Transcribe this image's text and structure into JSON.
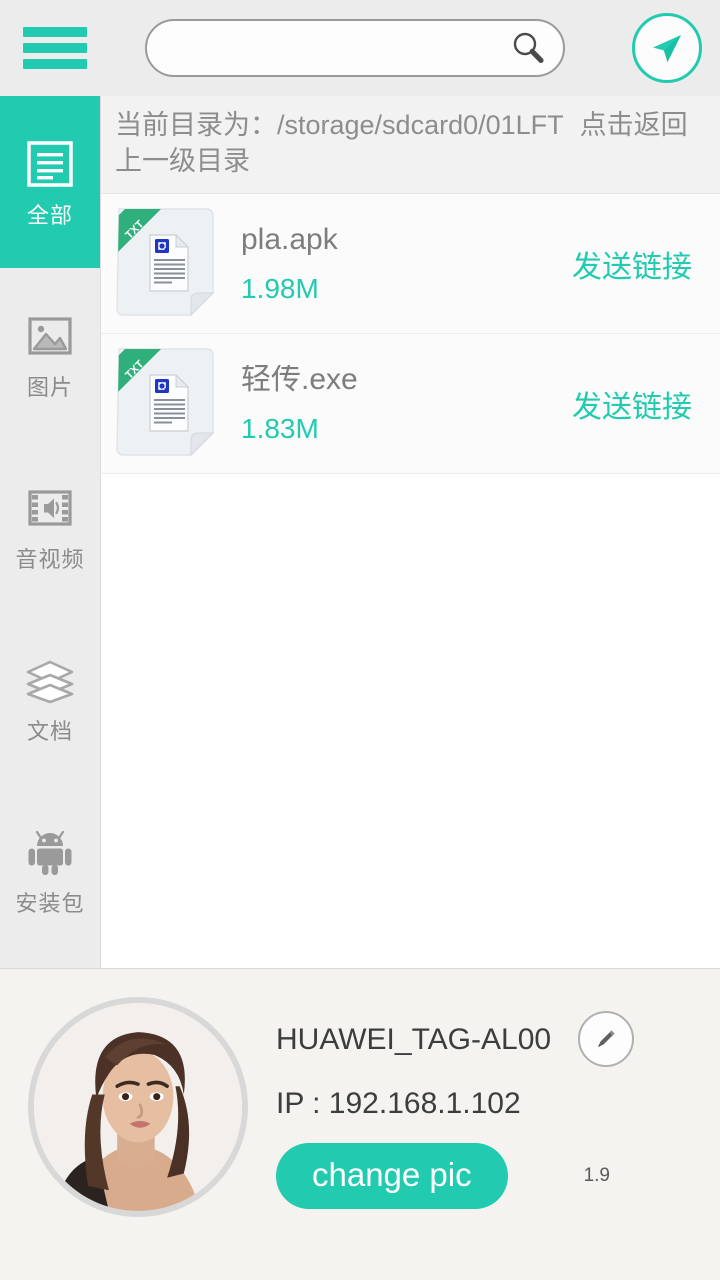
{
  "topbar": {
    "menu_icon": "hamburger-menu-icon",
    "search": {
      "value": "",
      "placeholder": ""
    },
    "search_icon": "search-icon",
    "send_icon": "send-paper-plane-icon"
  },
  "sidebar": {
    "items": [
      {
        "label": "全部",
        "icon": "document-lines-icon",
        "active": true
      },
      {
        "label": "图片",
        "icon": "image-picture-icon",
        "active": false
      },
      {
        "label": "音视频",
        "icon": "film-audio-icon",
        "active": false
      },
      {
        "label": "文档",
        "icon": "layers-stack-icon",
        "active": false
      },
      {
        "label": "安装包",
        "icon": "android-robot-icon",
        "active": false
      }
    ]
  },
  "main": {
    "path_label": "当前目录为：/storage/sdcard0/01LFT",
    "back_hint": "点击返回上一级目录",
    "files": [
      {
        "name": "pla.apk",
        "size": "1.98M",
        "action": "发送链接",
        "badge": "TXT",
        "icon": "txt-file-icon"
      },
      {
        "name": "轻传.exe",
        "size": "1.83M",
        "action": "发送链接",
        "badge": "TXT",
        "icon": "txt-file-icon"
      }
    ]
  },
  "footer": {
    "avatar_icon": "user-avatar-photo",
    "device_name": "HUAWEI_TAG-AL00",
    "ip_line": "IP : 192.168.1.102",
    "change_pic_label": "change pic",
    "edit_icon": "pencil-edit-icon",
    "version": "1.9"
  },
  "colors": {
    "accent": "#22cbaf",
    "topbar_bg": "#ececec",
    "sidebar_bg": "#ececec",
    "row_bg": "#fbfbfb",
    "footer_bg": "#f4f3f0",
    "text_gray": "#8b8b8b",
    "badge_green": "#2faf7c"
  }
}
